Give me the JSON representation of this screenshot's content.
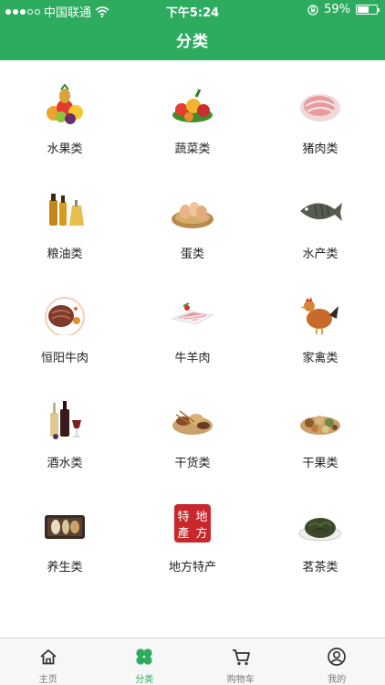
{
  "status_bar": {
    "carrier": "中国联通",
    "time": "下午5:24",
    "battery": "59%",
    "battery_level": 0.59,
    "signal_icon": "signal-dots-icon",
    "wifi_icon": "wifi-icon",
    "lock_icon": "rotation-lock-icon"
  },
  "header": {
    "title": "分类"
  },
  "categories": [
    {
      "label": "水果类",
      "icon": "fruits-icon"
    },
    {
      "label": "蔬菜类",
      "icon": "vegetables-icon"
    },
    {
      "label": "猪肉类",
      "icon": "pork-icon"
    },
    {
      "label": "粮油类",
      "icon": "grain-oil-icon"
    },
    {
      "label": "蛋类",
      "icon": "eggs-icon"
    },
    {
      "label": "水产类",
      "icon": "fish-icon"
    },
    {
      "label": "恒阳牛肉",
      "icon": "beef-steak-icon"
    },
    {
      "label": "牛羊肉",
      "icon": "beef-mutton-icon"
    },
    {
      "label": "家禽类",
      "icon": "poultry-icon"
    },
    {
      "label": "酒水类",
      "icon": "wine-icon"
    },
    {
      "label": "干货类",
      "icon": "dried-goods-icon"
    },
    {
      "label": "干果类",
      "icon": "nuts-icon"
    },
    {
      "label": "养生类",
      "icon": "health-food-icon"
    },
    {
      "label": "地方特产",
      "icon": "local-specialty-stamp-icon",
      "stamp_text": [
        "特",
        "地",
        "產",
        "方"
      ]
    },
    {
      "label": "茗茶类",
      "icon": "tea-icon"
    }
  ],
  "tabbar": {
    "tabs": [
      {
        "label": "主页",
        "icon": "home-icon",
        "active": false
      },
      {
        "label": "分类",
        "icon": "clover-icon",
        "active": true
      },
      {
        "label": "购物车",
        "icon": "cart-icon",
        "active": false
      },
      {
        "label": "我的",
        "icon": "user-icon",
        "active": false
      }
    ]
  },
  "colors": {
    "brand": "#2dab5f",
    "tab_inactive": "#7a7a7a",
    "text": "#222222"
  }
}
